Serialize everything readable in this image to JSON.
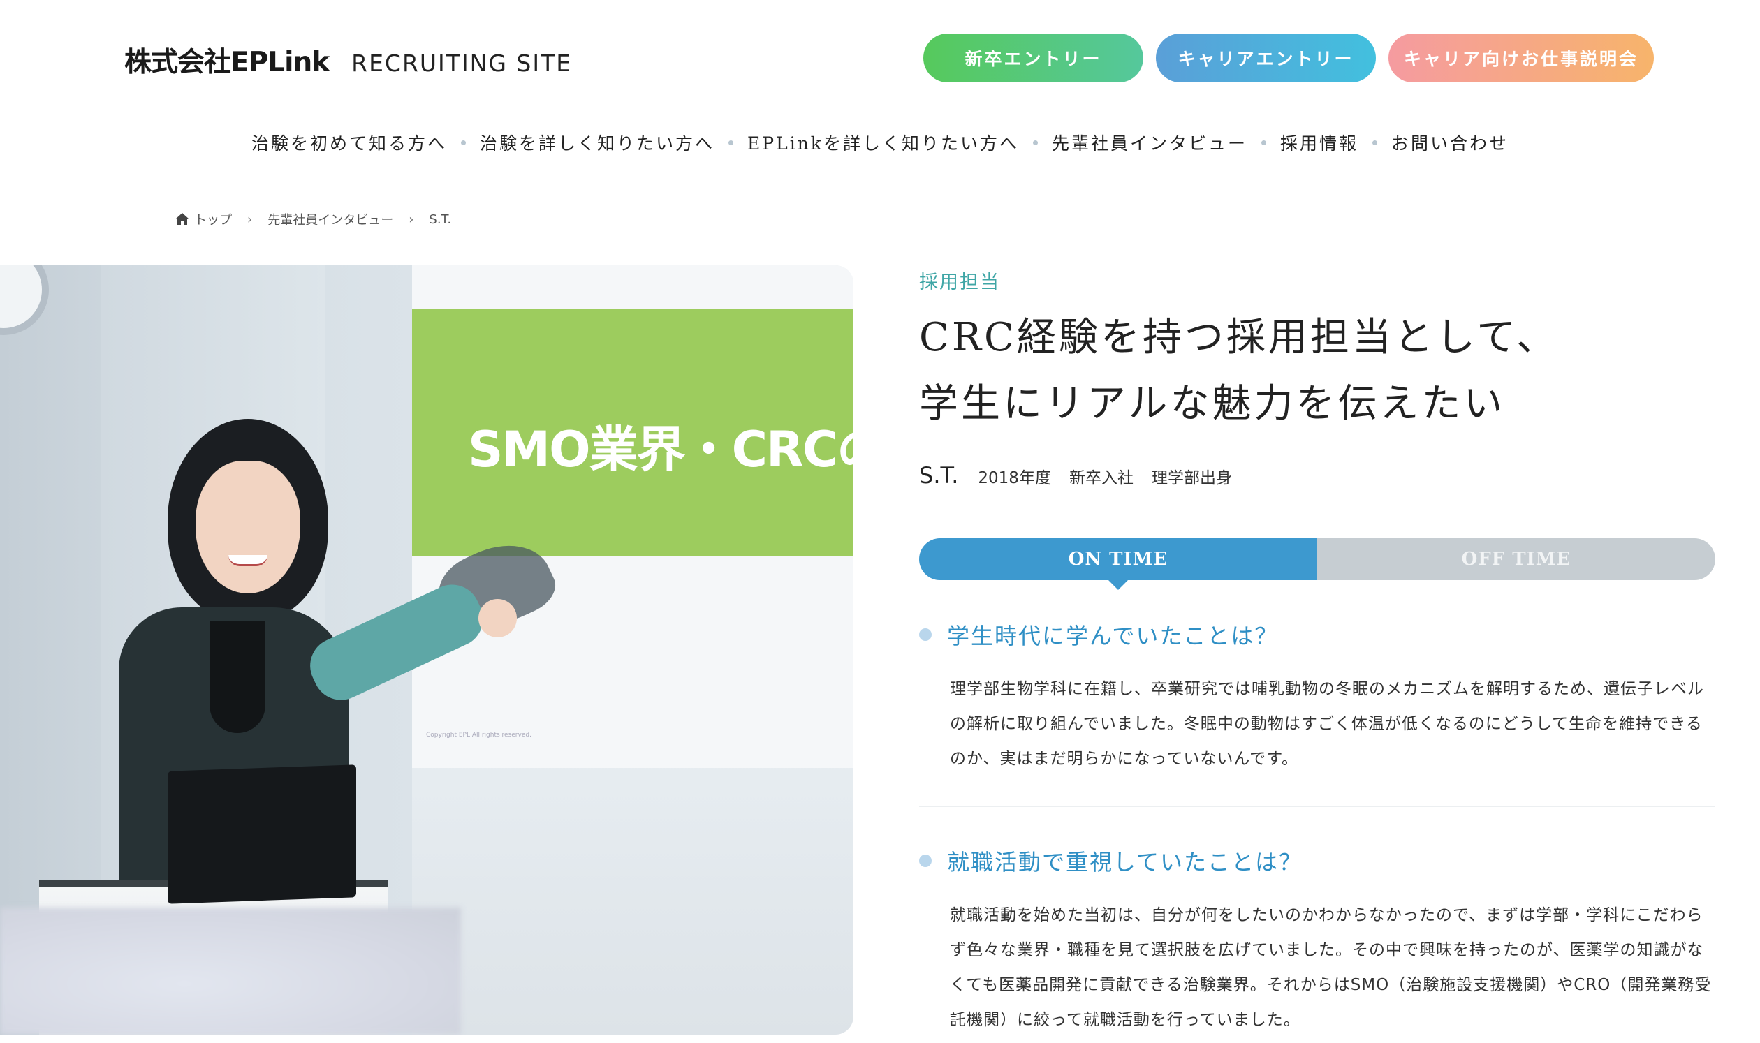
{
  "header": {
    "logo_name": "株式会社EPLink",
    "logo_sub": "RECRUITING SITE",
    "buttons": {
      "new_grad": "新卒エントリー",
      "career": "キャリアエントリー",
      "briefing": "キャリア向けお仕事説明会"
    }
  },
  "nav": {
    "items": [
      "治験を初めて知る方へ",
      "治験を詳しく知りたい方へ",
      "EPLinkを詳しく知りたい方へ",
      "先輩社員インタビュー",
      "採用情報",
      "お問い合わせ"
    ]
  },
  "breadcrumb": {
    "home": "トップ",
    "section": "先輩社員インタビュー",
    "current": "S.T."
  },
  "photo": {
    "screen_text": "SMO業界・CRCの仕",
    "screen_footer": "Copyright EPL All rights reserved."
  },
  "profile": {
    "category": "採用担当",
    "title_line1": "CRC経験を持つ採用担当として、",
    "title_line2": "学生にリアルな魅力を伝えたい",
    "initials": "S.T.",
    "year": "2018年度",
    "entry_type": "新卒入社",
    "faculty": "理学部出身"
  },
  "tabs": {
    "on": "ON TIME",
    "off": "OFF TIME"
  },
  "qa": [
    {
      "question": "学生時代に学んでいたことは？",
      "answer": "理学部生物学科に在籍し、卒業研究では哺乳動物の冬眠のメカニズムを解明するため、遺伝子レベルの解析に取り組んでいました。冬眠中の動物はすごく体温が低くなるのにどうして生命を維持できるのか、実はまだ明らかになっていないんです。"
    },
    {
      "question": "就職活動で重視していたことは？",
      "answer": "就職活動を始めた当初は、自分が何をしたいのかわからなかったので、まずは学部・学科にこだわらず色々な業界・職種を見て選択肢を広げていました。その中で興味を持ったのが、医薬学の知識がなくても医薬品開発に貢献できる治験業界。それからはSMO（治験施設支援機関）やCRO（開発業務受託機関）に絞って就職活動を行っていました。"
    }
  ],
  "colors": {
    "accent_blue": "#3d99cf",
    "category_teal": "#3fa6a6",
    "tab_off": "#c6cdd2"
  }
}
